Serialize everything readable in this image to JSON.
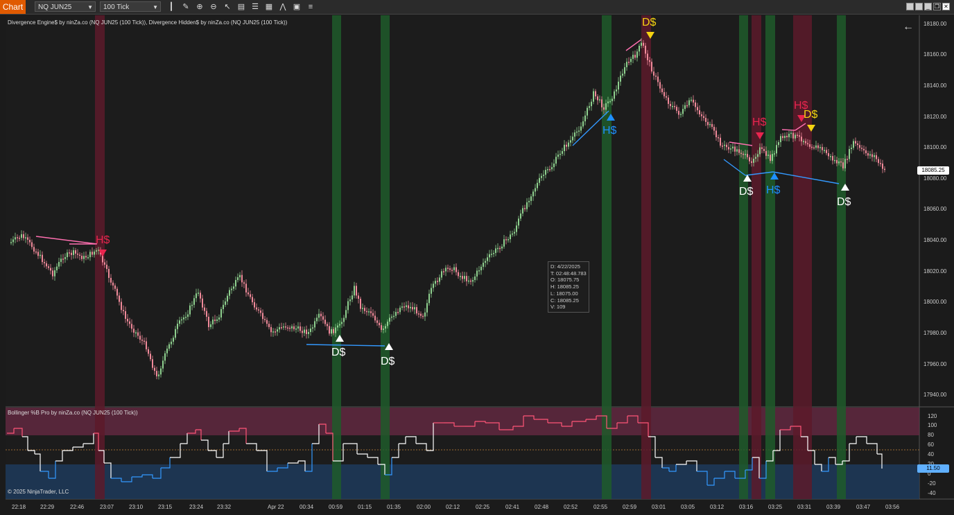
{
  "toolbar": {
    "chart_tab": "Chart",
    "instrument": "NQ JUN25",
    "interval": "100 Tick",
    "tools": [
      "bar-style-icon",
      "pencil-icon",
      "zoom-in-icon",
      "zoom-out-icon",
      "pointer-icon",
      "data-box-icon",
      "properties-icon",
      "drawing-tools-icon",
      "strategy-icon",
      "template-icon",
      "list-icon"
    ]
  },
  "panel_titles": {
    "price": "Divergence Engine$ by ninZa.co (NQ JUN25 (100 Tick)), Divergence Hidden$ by ninZa.co (NQ JUN25 (100 Tick))",
    "indicator": "Bollinger %B Pro by ninZa.co (NQ JUN25 (100 Tick))",
    "copyright": "© 2025 NinjaTrader, LLC"
  },
  "price_axis": [
    "18180.00",
    "18160.00",
    "18140.00",
    "18120.00",
    "18100.00",
    "18080.00",
    "18060.00",
    "18040.00",
    "18020.00",
    "18000.00",
    "17980.00",
    "17960.00",
    "17940.00"
  ],
  "last_price": "18085.25",
  "indicator_axis": [
    "120",
    "100",
    "80",
    "60",
    "40",
    "20",
    "0",
    "-20",
    "-40"
  ],
  "indicator_value": "11.50",
  "time_axis": [
    "22:18",
    "22:29",
    "22:46",
    "23:07",
    "23:10",
    "23:15",
    "23:24",
    "23:32",
    "Apr 22",
    "00:34",
    "00:59",
    "01:15",
    "01:35",
    "02:00",
    "02:12",
    "02:25",
    "02:41",
    "02:48",
    "02:52",
    "02:55",
    "02:59",
    "03:01",
    "03:05",
    "03:12",
    "03:16",
    "03:25",
    "03:31",
    "03:39",
    "03:47",
    "03:56"
  ],
  "data_box": {
    "date": "D:  4/22/2025",
    "time": "T:  02:48:48.783",
    "open": "O:  18075.75",
    "high": "H:  18085.25",
    "low": "L:  18075.00",
    "close": "C:  18085.25",
    "volume": "V:  109"
  },
  "signals": [
    {
      "text": "H$",
      "color": "#e8254e"
    },
    {
      "text": "D$",
      "color": "#ffffff"
    },
    {
      "text": "D$",
      "color": "#ffffff"
    },
    {
      "text": "H$",
      "color": "#1e90ff"
    },
    {
      "text": "D$",
      "color": "#f5d311"
    },
    {
      "text": "H$",
      "color": "#e8254e"
    },
    {
      "text": "D$",
      "color": "#ffffff"
    },
    {
      "text": "H$",
      "color": "#1e90ff"
    },
    {
      "text": "H$",
      "color": "#e8254e"
    },
    {
      "text": "D$",
      "color": "#f5d311"
    },
    {
      "text": "D$",
      "color": "#ffffff"
    }
  ],
  "colors": {
    "up_candle": "#8fd18f",
    "down_candle": "#f08a9a",
    "bull_band": "#1f5a2a",
    "bear_band": "#5c1a2a",
    "upper_zone": "#6a2a44",
    "lower_zone": "#1d3a5a",
    "bear_divergence": "#ff6fb0",
    "bull_divergence": "#3399ff"
  }
}
